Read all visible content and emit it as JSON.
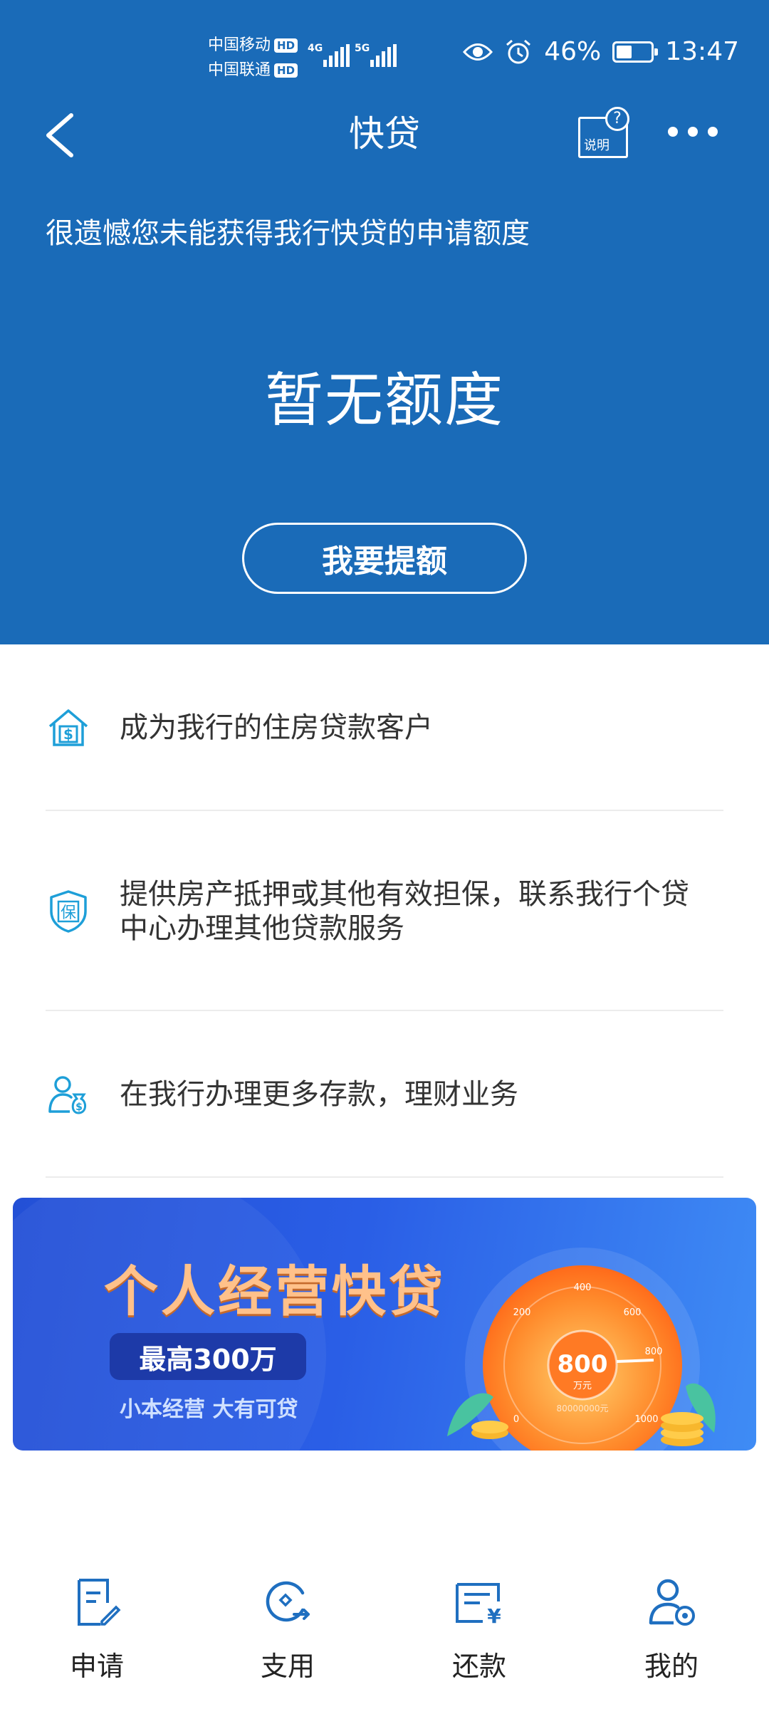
{
  "status_bar": {
    "carrier1": "中国移动",
    "carrier2": "中国联通",
    "hd": "HD",
    "net1": "4G",
    "net2": "5G",
    "battery_pct_text": "46%",
    "battery_level": 0.46,
    "time": "13:47"
  },
  "nav": {
    "title": "快贷",
    "help_label": "说明",
    "help_mark": "?"
  },
  "hero": {
    "notice": "很遗憾您未能获得我行快贷的申请额度",
    "quota_text": "暂无额度",
    "raise_button": "我要提额"
  },
  "tips": [
    {
      "icon": "house-dollar-icon",
      "text": "成为我行的住房贷款客户"
    },
    {
      "icon": "shield-guarantee-icon",
      "text": "提供房产抵押或其他有效担保，联系我行个贷中心办理其他贷款服务",
      "icon_char": "保"
    },
    {
      "icon": "person-money-icon",
      "text": "在我行办理更多存款，理财业务"
    }
  ],
  "banner": {
    "title": "个人经营快贷",
    "highlight": "最高300万",
    "slogan": "小本经营 大有可贷",
    "gauge_value": "800",
    "gauge_unit": "万元",
    "gauge_ticks": [
      "0",
      "200",
      "400",
      "600",
      "800",
      "1000"
    ],
    "gauge_caption": "80000000元"
  },
  "tabbar": [
    {
      "label": "申请",
      "icon": "apply-icon"
    },
    {
      "label": "支用",
      "icon": "draw-icon"
    },
    {
      "label": "还款",
      "icon": "repay-icon"
    },
    {
      "label": "我的",
      "icon": "profile-icon"
    }
  ],
  "colors": {
    "primary_blue": "#1a6bb8",
    "icon_teal": "#1e9fd8",
    "tab_icon_blue": "#1f6fc0",
    "banner_title": "#ffc18a"
  }
}
